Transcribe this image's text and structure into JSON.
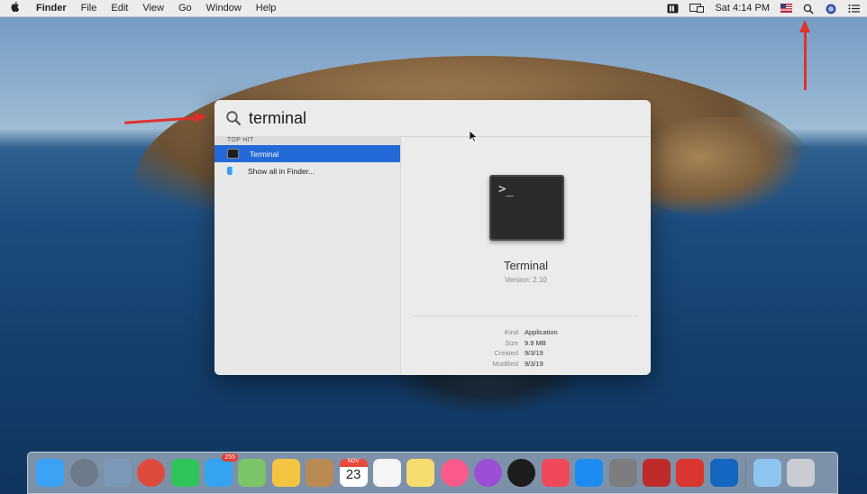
{
  "menubar": {
    "apple_icon": "apple-logo-icon",
    "app_name": "Finder",
    "menus": [
      "File",
      "Edit",
      "View",
      "Go",
      "Window",
      "Help"
    ],
    "clock": "Sat 4:14 PM",
    "status_icons": [
      "menu-extra-icon",
      "display-mirroring-icon",
      "us-flag-input-icon",
      "spotlight-search-icon",
      "siri-icon",
      "notification-center-icon"
    ]
  },
  "spotlight": {
    "query": "terminal",
    "section_title": "TOP HIT",
    "results": [
      {
        "label": "Terminal",
        "icon": "terminal-icon",
        "selected": true
      },
      {
        "label": "Show all in Finder...",
        "icon": "finder-icon",
        "selected": false
      }
    ],
    "preview": {
      "prompt": ">_",
      "app_name": "Terminal",
      "version": "Version: 2.10",
      "meta": [
        {
          "key": "Kind",
          "value": "Application"
        },
        {
          "key": "Size",
          "value": "9.9 MB"
        },
        {
          "key": "Created",
          "value": "9/3/19"
        },
        {
          "key": "Modified",
          "value": "9/3/19"
        }
      ]
    }
  },
  "dock": {
    "messages_badge": "255",
    "calendar_month": "NOV",
    "calendar_day": "23",
    "apps": [
      {
        "name": "finder-icon",
        "color": "#3aa3f5"
      },
      {
        "name": "launchpad-icon",
        "color": "#6c7a89"
      },
      {
        "name": "preview-icon",
        "color": "#7c98b8"
      },
      {
        "name": "chrome-icon",
        "color": "#dd4b3e"
      },
      {
        "name": "facetime-icon",
        "color": "#2fc35a"
      },
      {
        "name": "messages-icon",
        "color": "#34a3f2"
      },
      {
        "name": "maps-icon",
        "color": "#7cc46a"
      },
      {
        "name": "photos-icon",
        "color": "#f4c542"
      },
      {
        "name": "contacts-icon",
        "color": "#b98a52"
      },
      {
        "name": "calendar-icon",
        "color": "#ffffff"
      },
      {
        "name": "reminders-icon",
        "color": "#f5f5f5"
      },
      {
        "name": "notes-icon",
        "color": "#f7dc6f"
      },
      {
        "name": "itunes-icon",
        "color": "#fa5b8c"
      },
      {
        "name": "podcasts-icon",
        "color": "#9b4fd6"
      },
      {
        "name": "apple-tv-icon",
        "color": "#1c1c1c"
      },
      {
        "name": "news-icon",
        "color": "#f04a5a"
      },
      {
        "name": "app-store-icon",
        "color": "#1d8cf2"
      },
      {
        "name": "system-preferences-icon",
        "color": "#7d7d80"
      },
      {
        "name": "filezilla-icon",
        "color": "#bf2a2a"
      },
      {
        "name": "mindnode-icon",
        "color": "#d8362e"
      },
      {
        "name": "outlook-icon",
        "color": "#1466c0"
      },
      {
        "name": "downloads-folder-icon",
        "color": "#8ec5f0"
      },
      {
        "name": "trash-icon",
        "color": "#c9ccd2"
      }
    ]
  }
}
